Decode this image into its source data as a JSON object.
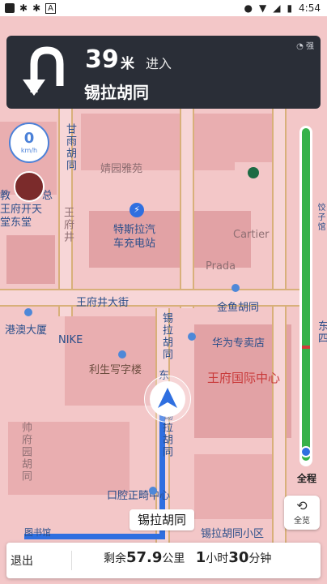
{
  "status_bar": {
    "time": "4:54",
    "icons_left": [
      "app-square-icon",
      "bug-icon",
      "bug-icon",
      "a-box-icon"
    ],
    "icons_right": [
      "location-icon",
      "wifi-icon",
      "signal-icon",
      "battery-icon"
    ]
  },
  "nav": {
    "turn_icon": "u-turn-icon",
    "distance": "39",
    "distance_unit": "米",
    "action": "进入",
    "street": "锡拉胡同",
    "signal": "强"
  },
  "speed": {
    "value": "0",
    "unit": "km/h"
  },
  "map_labels": {
    "l1": "婧园雅苑",
    "l2": "特斯拉汽",
    "l3": "车充电站",
    "l4": "Cartier",
    "l5": "Prada",
    "l6": "王府井大街",
    "l7": "金鱼胡同",
    "l8": "港澳大厦",
    "l9": "NIKE",
    "l10": "华为专卖店",
    "l11": "利生写字楼",
    "l12": "王府国际中心",
    "l13": "东",
    "l14": "口腔正畸中心",
    "l15": "锡拉胡同小区",
    "l16": "教",
    "l17": "总",
    "l18": "王府开天",
    "l19": "堂东堂",
    "l20": "图书馆",
    "v1": "甘雨胡同",
    "v2": "锡拉胡同",
    "v3": "锡拉胡同",
    "v4": "王府井",
    "v5": "东四",
    "v6": "饺子馆",
    "v7": "帅府园胡同"
  },
  "progress": {
    "label": "全程",
    "traveled_fraction": 0.96
  },
  "overview_button": {
    "label": "全览"
  },
  "street_pill": "锡拉胡同",
  "bottom": {
    "exit": "退出",
    "remain_label": "剩余",
    "remain_dist": "57.9",
    "remain_unit": "公里",
    "time_h": "1",
    "time_h_unit": "小时",
    "time_m": "30",
    "time_m_unit": "分钟"
  }
}
